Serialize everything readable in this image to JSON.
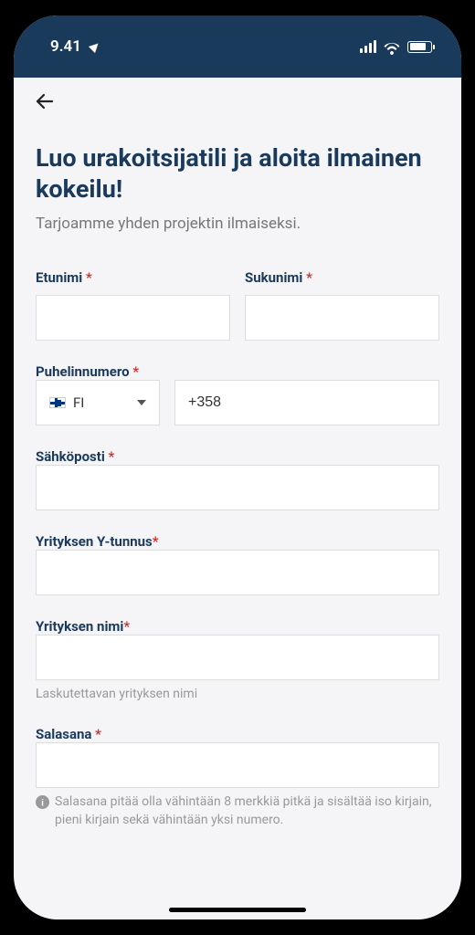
{
  "status": {
    "time": "9.41"
  },
  "heading": "Luo urakoitsijatili ja aloita ilmainen kokeilu!",
  "subheading": "Tarjoamme yhden projektin ilmaiseksi.",
  "fields": {
    "firstName": {
      "label": "Etunimi",
      "value": ""
    },
    "lastName": {
      "label": "Sukunimi",
      "value": ""
    },
    "phone": {
      "label": "Puhelinnumero",
      "country": "FI",
      "prefix": "+358",
      "value": ""
    },
    "email": {
      "label": "Sähköposti",
      "value": ""
    },
    "businessId": {
      "label": "Yrityksen Y-tunnus",
      "value": ""
    },
    "companyName": {
      "label": "Yrityksen nimi",
      "value": "",
      "helper": "Laskutettavan yrityksen nimi"
    },
    "password": {
      "label": "Salasana",
      "value": "",
      "helper": "Salasana pitää olla vähintään 8 merkkiä pitkä ja sisältää iso kirjain, pieni kirjain sekä vähintään yksi numero."
    }
  },
  "requiredMark": " *"
}
